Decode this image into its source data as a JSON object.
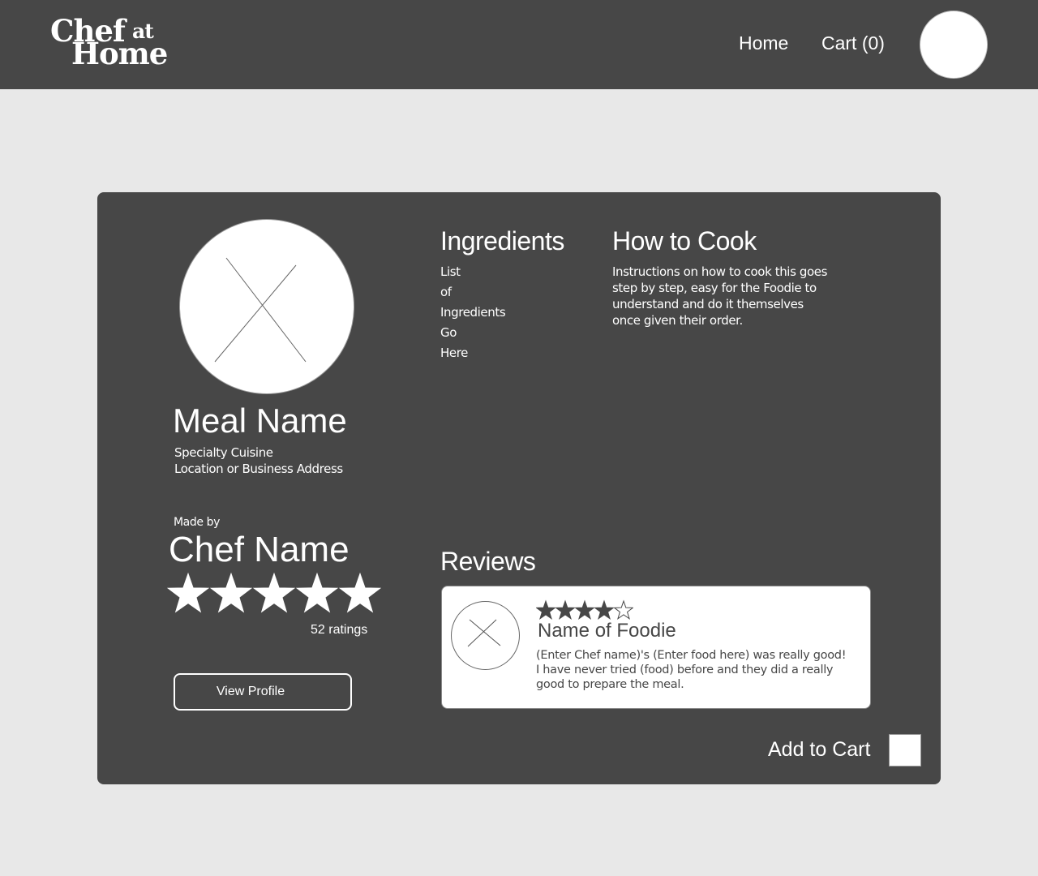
{
  "header": {
    "logo": {
      "word1": "Chef",
      "word2": "at",
      "word3": "Home"
    },
    "nav": {
      "home": "Home",
      "cart": "Cart (0)"
    }
  },
  "meal": {
    "name": "Meal Name",
    "cuisine": "Specialty Cuisine",
    "address": "Location or Business Address"
  },
  "chef": {
    "made_by": "Made by",
    "name": "Chef Name",
    "rating": 5,
    "max_rating": 5,
    "ratings_count": "52 ratings",
    "view_profile": "View Profile"
  },
  "ingredients": {
    "heading": "Ingredients",
    "items": [
      "List",
      "of",
      "Ingredients",
      "Go",
      "Here"
    ]
  },
  "how_to_cook": {
    "heading": "How to Cook",
    "text": "Instructions on how to cook this goes step by step, easy for the Foodie to understand and do it themselves once given their order."
  },
  "reviews": {
    "heading": "Reviews",
    "items": [
      {
        "rating": 4,
        "max_rating": 5,
        "name": "Name of Foodie",
        "text": "(Enter Chef name)'s (Enter food here) was really good! I have never tried (food) before and they did a really good to prepare the meal."
      }
    ]
  },
  "add_to_cart": {
    "label": "Add to Cart"
  },
  "colors": {
    "header_bg": "#474747",
    "page_bg": "#e8e8e8",
    "card_bg": "#474747",
    "text_light": "#ffffff",
    "text_dark": "#474747"
  },
  "icons": {
    "logo": "chef-at-home-logo",
    "profile": "profile-avatar-icon",
    "image_placeholder": "image-placeholder-icon",
    "star": "star-icon",
    "checkbox": "checkbox-icon"
  }
}
